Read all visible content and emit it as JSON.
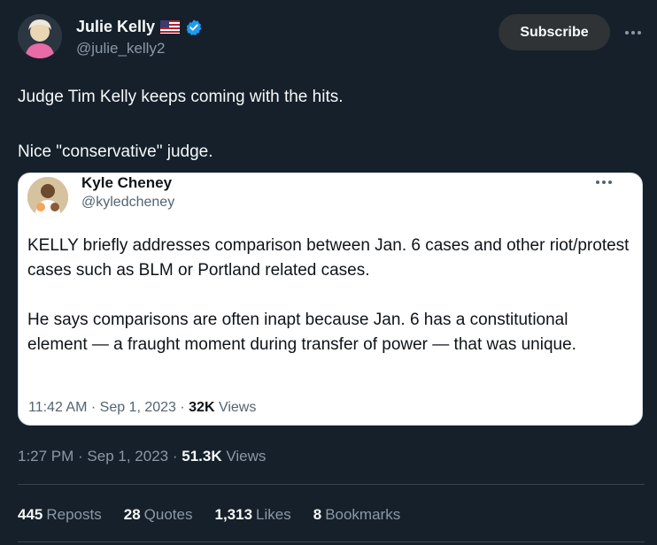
{
  "author": {
    "name": "Julie Kelly",
    "handle": "@julie_kelly2",
    "flag": "us-flag-emoji",
    "verified": "verified-badge-icon"
  },
  "actions": {
    "subscribe_label": "Subscribe",
    "more_icon": "more-icon"
  },
  "tweet": {
    "text": "Judge Tim Kelly keeps coming with the hits.\n\nNice \"conservative\" judge.",
    "time": "1:27 PM",
    "date": "Sep 1, 2023",
    "views_count": "51.3K",
    "views_label": "Views"
  },
  "quoted": {
    "name": "Kyle Cheney",
    "handle": "@kyledcheney",
    "text": "KELLY briefly addresses comparison between Jan. 6 cases and other riot/protest cases such as BLM or Portland related cases.\n\nHe says comparisons are often inapt because Jan. 6 has a constitutional element — a fraught moment during transfer of power — that was unique.",
    "time": "11:42 AM",
    "date": "Sep 1, 2023",
    "views_count": "32K",
    "views_label": "Views"
  },
  "stats": [
    {
      "count": "445",
      "label": "Reposts"
    },
    {
      "count": "28",
      "label": "Quotes"
    },
    {
      "count": "1,313",
      "label": "Likes"
    },
    {
      "count": "8",
      "label": "Bookmarks"
    }
  ],
  "colors": {
    "background": "#15202b",
    "verified": "#1d9bf0",
    "card": "#ffffff"
  }
}
